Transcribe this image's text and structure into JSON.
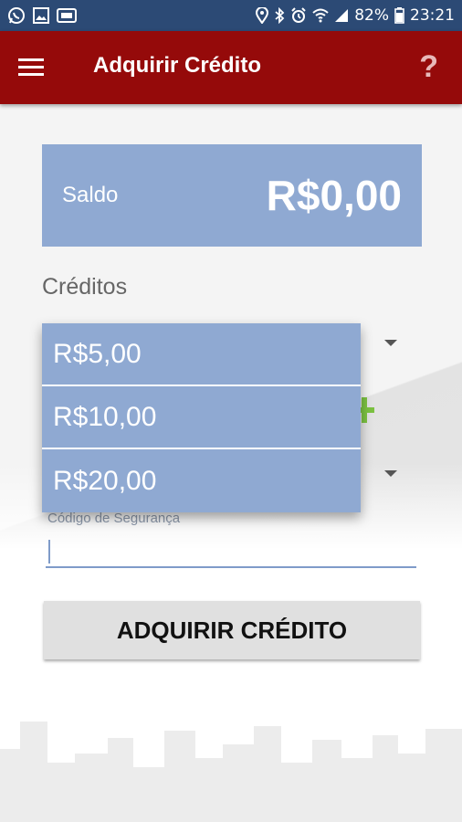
{
  "status_bar": {
    "battery": "82%",
    "time": "23:21",
    "left_icons": [
      "whatsapp-icon",
      "gallery-icon",
      "qd-icon"
    ],
    "right_icons": [
      "location-icon",
      "bluetooth-icon",
      "alarm-icon",
      "wifi-icon",
      "signal-icon",
      "battery-icon"
    ]
  },
  "app_bar": {
    "title": "Adquirir Crédito",
    "help_symbol": "?"
  },
  "balance": {
    "label": "Saldo",
    "value": "R$0,00"
  },
  "credits": {
    "label": "Créditos",
    "options": [
      "R$5,00",
      "R$10,00",
      "R$20,00"
    ]
  },
  "security": {
    "label": "Código de Segurança",
    "value": ""
  },
  "actions": {
    "buy_label": "ADQUIRIR CRÉDITO"
  },
  "colors": {
    "status_bar": "#2c4a75",
    "app_bar": "#950a0a",
    "card": "#8fa9d2",
    "accent_green": "#7cc242"
  }
}
